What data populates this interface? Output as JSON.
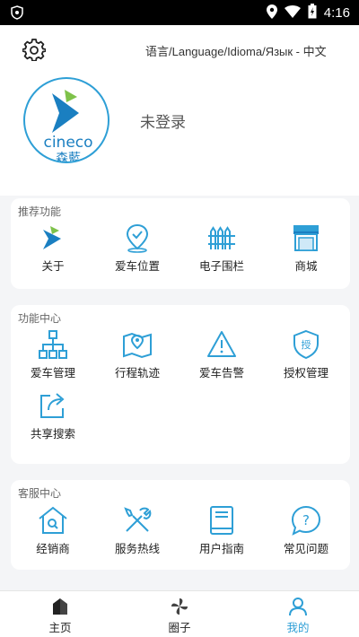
{
  "status": {
    "time": "4:16"
  },
  "header": {
    "language_selector": "语言/Language/Idioma/Язык - 中文",
    "login_text": "未登录",
    "logo_text": "cineco",
    "logo_subtext": "森藍"
  },
  "recommended": {
    "title": "推荐功能",
    "items": [
      {
        "label": "关于",
        "icon": "cineco-logo-icon"
      },
      {
        "label": "爱车位置",
        "icon": "location-pin-icon"
      },
      {
        "label": "电子围栏",
        "icon": "fence-icon"
      },
      {
        "label": "商城",
        "icon": "store-icon"
      }
    ]
  },
  "functions": {
    "title": "功能中心",
    "items": [
      {
        "label": "爱车管理",
        "icon": "hierarchy-icon"
      },
      {
        "label": "行程轨迹",
        "icon": "map-route-icon"
      },
      {
        "label": "爱车告警",
        "icon": "warning-icon"
      },
      {
        "label": "授权管理",
        "icon": "authorize-shield-icon"
      },
      {
        "label": "共享搜索",
        "icon": "share-icon"
      }
    ],
    "auth_badge": "授"
  },
  "service": {
    "title": "客服中心",
    "items": [
      {
        "label": "经销商",
        "icon": "dealer-house-icon"
      },
      {
        "label": "服务热线",
        "icon": "tools-icon"
      },
      {
        "label": "用户指南",
        "icon": "guide-book-icon"
      },
      {
        "label": "常见问题",
        "icon": "faq-icon"
      }
    ],
    "faq_mark": "?"
  },
  "tabs": [
    {
      "label": "主页",
      "icon": "home-icon",
      "active": false
    },
    {
      "label": "圈子",
      "icon": "pinwheel-icon",
      "active": false
    },
    {
      "label": "我的",
      "icon": "person-icon",
      "active": true
    }
  ],
  "colors": {
    "accent": "#2e9fd6",
    "logo_green": "#7ec24a",
    "background": "#f4f5f7"
  }
}
